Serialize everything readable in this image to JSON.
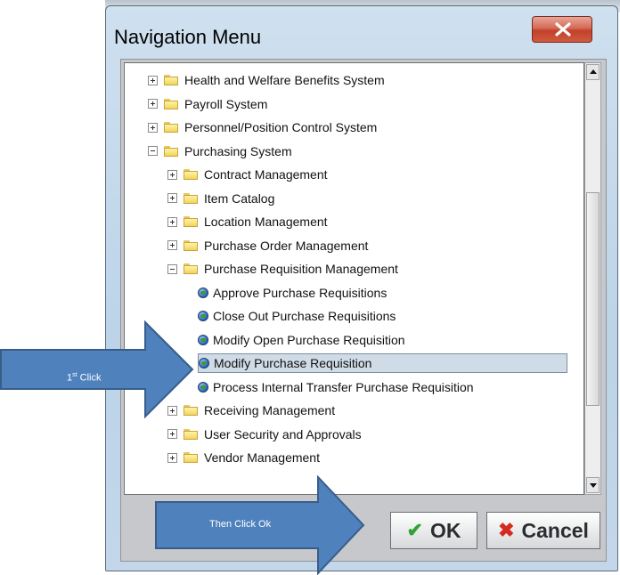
{
  "dialog": {
    "title": "Navigation Menu",
    "ok_label": "OK",
    "cancel_label": "Cancel"
  },
  "tree": {
    "items": [
      {
        "label": "Health and Welfare Benefits System",
        "type": "folder",
        "expander": "plus",
        "level": 0
      },
      {
        "label": "Payroll System",
        "type": "folder",
        "expander": "plus",
        "level": 0
      },
      {
        "label": "Personnel/Position Control System",
        "type": "folder",
        "expander": "plus",
        "level": 0
      },
      {
        "label": "Purchasing System",
        "type": "folder",
        "expander": "minus",
        "level": 0
      },
      {
        "label": "Contract Management",
        "type": "folder",
        "expander": "plus",
        "level": 1
      },
      {
        "label": "Item Catalog",
        "type": "folder",
        "expander": "plus",
        "level": 1
      },
      {
        "label": "Location Management",
        "type": "folder",
        "expander": "plus",
        "level": 1
      },
      {
        "label": "Purchase Order Management",
        "type": "folder",
        "expander": "plus",
        "level": 1
      },
      {
        "label": "Purchase Requisition Management",
        "type": "folder",
        "expander": "minus",
        "level": 1
      },
      {
        "label": "Approve Purchase Requisitions",
        "type": "action",
        "level": 2
      },
      {
        "label": "Close Out Purchase Requisitions",
        "type": "action",
        "level": 2
      },
      {
        "label": "Modify Open Purchase Requisition",
        "type": "action",
        "level": 2
      },
      {
        "label": "Modify Purchase Requisition",
        "type": "action",
        "level": 2,
        "selected": true
      },
      {
        "label": "Process Internal Transfer Purchase Requisition",
        "type": "action",
        "level": 2
      },
      {
        "label": "Receiving Management",
        "type": "folder",
        "expander": "plus",
        "level": 1
      },
      {
        "label": "User Security and Approvals",
        "type": "folder",
        "expander": "plus",
        "level": 1
      },
      {
        "label": "Vendor Management",
        "type": "folder",
        "expander": "plus",
        "level": 1
      }
    ]
  },
  "annotations": {
    "first": {
      "prefix": "1",
      "sup": "st",
      "suffix": " Click"
    },
    "second": {
      "text": "Then Click Ok"
    }
  },
  "colors": {
    "arrow_fill": "#4f81bd",
    "arrow_stroke": "#385d8a",
    "selection": "#cfdbe6"
  }
}
